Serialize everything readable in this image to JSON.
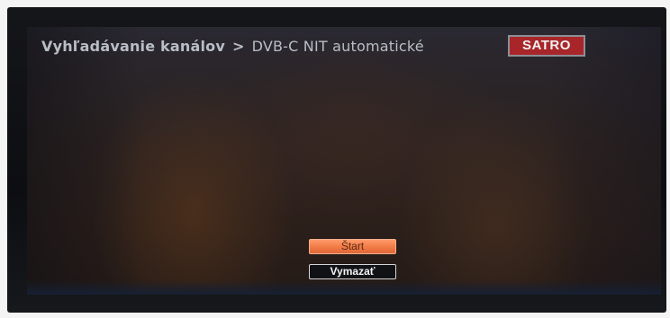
{
  "header": {
    "title": "Vyhľadávanie kanálov",
    "separator": ">",
    "subtitle": "DVB-C NIT automatické"
  },
  "brand": {
    "logo_text": "SATRO",
    "logo_color": "#a8262a"
  },
  "buttons": {
    "start_label": "Štart",
    "clear_label": "Vymazať"
  },
  "colors": {
    "focused_button": "#f07a45",
    "header_text": "#b9bec6"
  }
}
